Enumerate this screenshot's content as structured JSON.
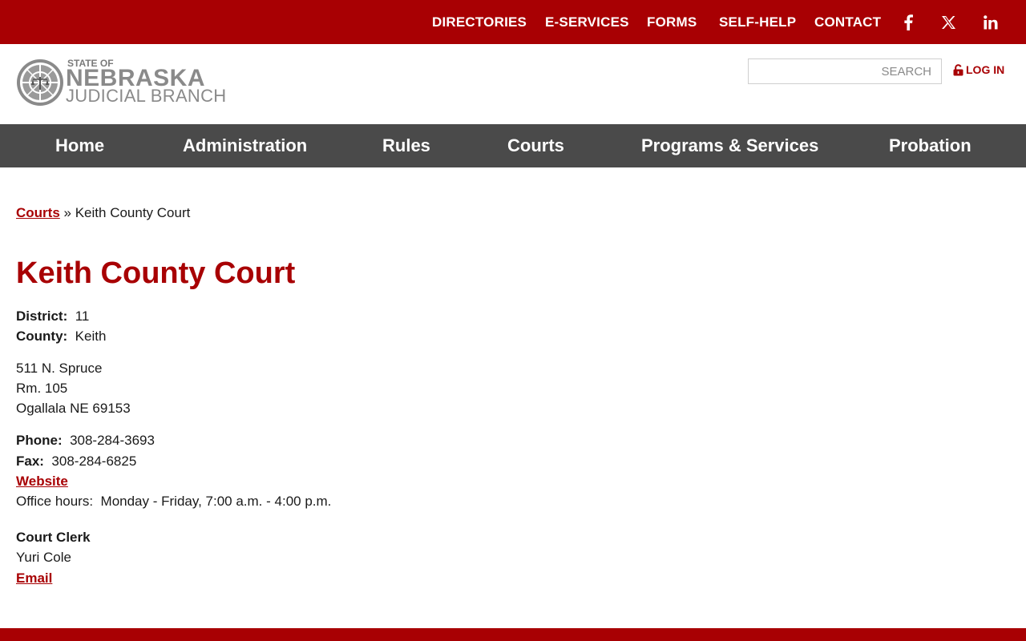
{
  "colors": {
    "brand_red": "#a80003",
    "nav_gray": "#4a4a4a",
    "text": "#1a1a1a"
  },
  "top_nav": {
    "items": [
      "DIRECTORIES",
      "E-SERVICES",
      "FORMS",
      "SELF-HELP",
      "CONTACT"
    ],
    "social_icons": [
      "facebook-icon",
      "x-twitter-icon",
      "linkedin-icon"
    ]
  },
  "header": {
    "logo": {
      "line1": "STATE OF",
      "line2": "NEBRASKA",
      "line3": "JUDICIAL BRANCH"
    },
    "search_placeholder": "SEARCH",
    "login_label": "LOG IN",
    "login_icon": "lock-icon"
  },
  "main_nav": {
    "items": [
      "Home",
      "Administration",
      "Rules",
      "Courts",
      "Programs & Services",
      "Probation"
    ]
  },
  "breadcrumb": {
    "parent": "Courts",
    "separator": "»",
    "current": "Keith County Court"
  },
  "court": {
    "title": "Keith County Court",
    "district_label": "District:",
    "district_value": "11",
    "county_label": "County:",
    "county_value": "Keith",
    "address": [
      "511 N. Spruce",
      "Rm. 105",
      "Ogallala NE 69153"
    ],
    "phone_label": "Phone:",
    "phone_value": "308-284-3693",
    "fax_label": "Fax:",
    "fax_value": "308-284-6825",
    "website_label": "Website",
    "hours_label": "Office hours:",
    "hours_value": "Monday - Friday, 7:00 a.m. - 4:00 p.m.",
    "clerk_heading": "Court Clerk",
    "clerk_name": "Yuri Cole",
    "email_label": "Email"
  }
}
